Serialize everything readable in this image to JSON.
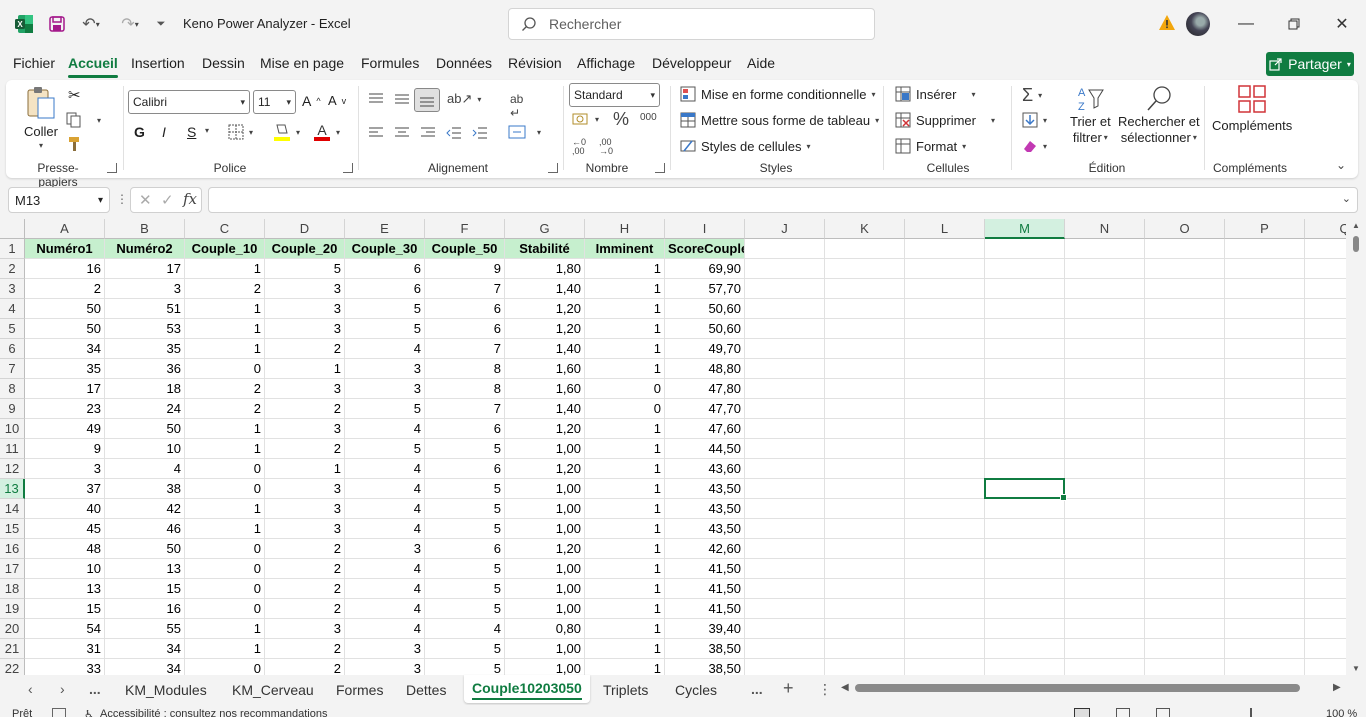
{
  "titlebar": {
    "app_icon": "excel-icon",
    "title": "Keno Power Analyzer  -  Excel",
    "search_placeholder": "Rechercher",
    "warning_icon": "warning-icon"
  },
  "menu": {
    "tabs": [
      "Fichier",
      "Accueil",
      "Insertion",
      "Dessin",
      "Mise en page",
      "Formules",
      "Données",
      "Révision",
      "Affichage",
      "Développeur",
      "Aide"
    ],
    "active": "Accueil",
    "share": "Partager"
  },
  "ribbon": {
    "clipboard": {
      "paste": "Coller",
      "label": "Presse-papiers"
    },
    "font": {
      "name": "Calibri",
      "size": "11",
      "bold": "G",
      "italic": "I",
      "underline": "S",
      "label": "Police"
    },
    "alignment": {
      "label": "Alignement"
    },
    "number": {
      "format": "Standard",
      "label": "Nombre"
    },
    "styles": {
      "conditional": "Mise en forme conditionnelle",
      "table": "Mettre sous forme de tableau",
      "cell_styles": "Styles de cellules",
      "label": "Styles"
    },
    "cells": {
      "insert": "Insérer",
      "delete": "Supprimer",
      "format": "Format",
      "label": "Cellules"
    },
    "editing": {
      "sort_1": "Trier et",
      "sort_2": "filtrer",
      "find_1": "Rechercher et",
      "find_2": "sélectionner",
      "label": "Édition"
    },
    "addins": {
      "button": "Compléments",
      "label": "Compléments"
    }
  },
  "formula_bar": {
    "name_box": "M13",
    "formula": ""
  },
  "sheet": {
    "columns": [
      "A",
      "B",
      "C",
      "D",
      "E",
      "F",
      "G",
      "H",
      "I",
      "J",
      "K",
      "L",
      "M",
      "N",
      "O",
      "P",
      "Q"
    ],
    "selected_column": "M",
    "selected_row": "13",
    "headers": [
      "Numéro1",
      "Numéro2",
      "Couple_10",
      "Couple_20",
      "Couple_30",
      "Couple_50",
      "Stabilité",
      "Imminent",
      "ScoreCouple"
    ],
    "rows": [
      [
        "16",
        "17",
        "1",
        "5",
        "6",
        "9",
        "1,80",
        "1",
        "69,90"
      ],
      [
        "2",
        "3",
        "2",
        "3",
        "6",
        "7",
        "1,40",
        "1",
        "57,70"
      ],
      [
        "50",
        "51",
        "1",
        "3",
        "5",
        "6",
        "1,20",
        "1",
        "50,60"
      ],
      [
        "50",
        "53",
        "1",
        "3",
        "5",
        "6",
        "1,20",
        "1",
        "50,60"
      ],
      [
        "34",
        "35",
        "1",
        "2",
        "4",
        "7",
        "1,40",
        "1",
        "49,70"
      ],
      [
        "35",
        "36",
        "0",
        "1",
        "3",
        "8",
        "1,60",
        "1",
        "48,80"
      ],
      [
        "17",
        "18",
        "2",
        "3",
        "3",
        "8",
        "1,60",
        "0",
        "47,80"
      ],
      [
        "23",
        "24",
        "2",
        "2",
        "5",
        "7",
        "1,40",
        "0",
        "47,70"
      ],
      [
        "49",
        "50",
        "1",
        "3",
        "4",
        "6",
        "1,20",
        "1",
        "47,60"
      ],
      [
        "9",
        "10",
        "1",
        "2",
        "5",
        "5",
        "1,00",
        "1",
        "44,50"
      ],
      [
        "3",
        "4",
        "0",
        "1",
        "4",
        "6",
        "1,20",
        "1",
        "43,60"
      ],
      [
        "37",
        "38",
        "0",
        "3",
        "4",
        "5",
        "1,00",
        "1",
        "43,50"
      ],
      [
        "40",
        "42",
        "1",
        "3",
        "4",
        "5",
        "1,00",
        "1",
        "43,50"
      ],
      [
        "45",
        "46",
        "1",
        "3",
        "4",
        "5",
        "1,00",
        "1",
        "43,50"
      ],
      [
        "48",
        "50",
        "0",
        "2",
        "3",
        "6",
        "1,20",
        "1",
        "42,60"
      ],
      [
        "10",
        "13",
        "0",
        "2",
        "4",
        "5",
        "1,00",
        "1",
        "41,50"
      ],
      [
        "13",
        "15",
        "0",
        "2",
        "4",
        "5",
        "1,00",
        "1",
        "41,50"
      ],
      [
        "15",
        "16",
        "0",
        "2",
        "4",
        "5",
        "1,00",
        "1",
        "41,50"
      ],
      [
        "54",
        "55",
        "1",
        "3",
        "4",
        "4",
        "0,80",
        "1",
        "39,40"
      ],
      [
        "31",
        "34",
        "1",
        "2",
        "3",
        "5",
        "1,00",
        "1",
        "38,50"
      ],
      [
        "33",
        "34",
        "0",
        "2",
        "3",
        "5",
        "1,00",
        "1",
        "38,50"
      ]
    ]
  },
  "sheet_tabs": {
    "more": "...",
    "tabs": [
      "KM_Modules",
      "KM_Cerveau",
      "Formes",
      "Dettes",
      "Couple10203050",
      "Triplets",
      "Cycles"
    ],
    "active": "Couple10203050"
  },
  "status": {
    "left_1": "Prêt",
    "left_2": "Accessibilité : consultez nos recommandations",
    "zoom": "100 %"
  },
  "colors": {
    "accent": "#107c41",
    "header_fill": "#c6efce"
  }
}
